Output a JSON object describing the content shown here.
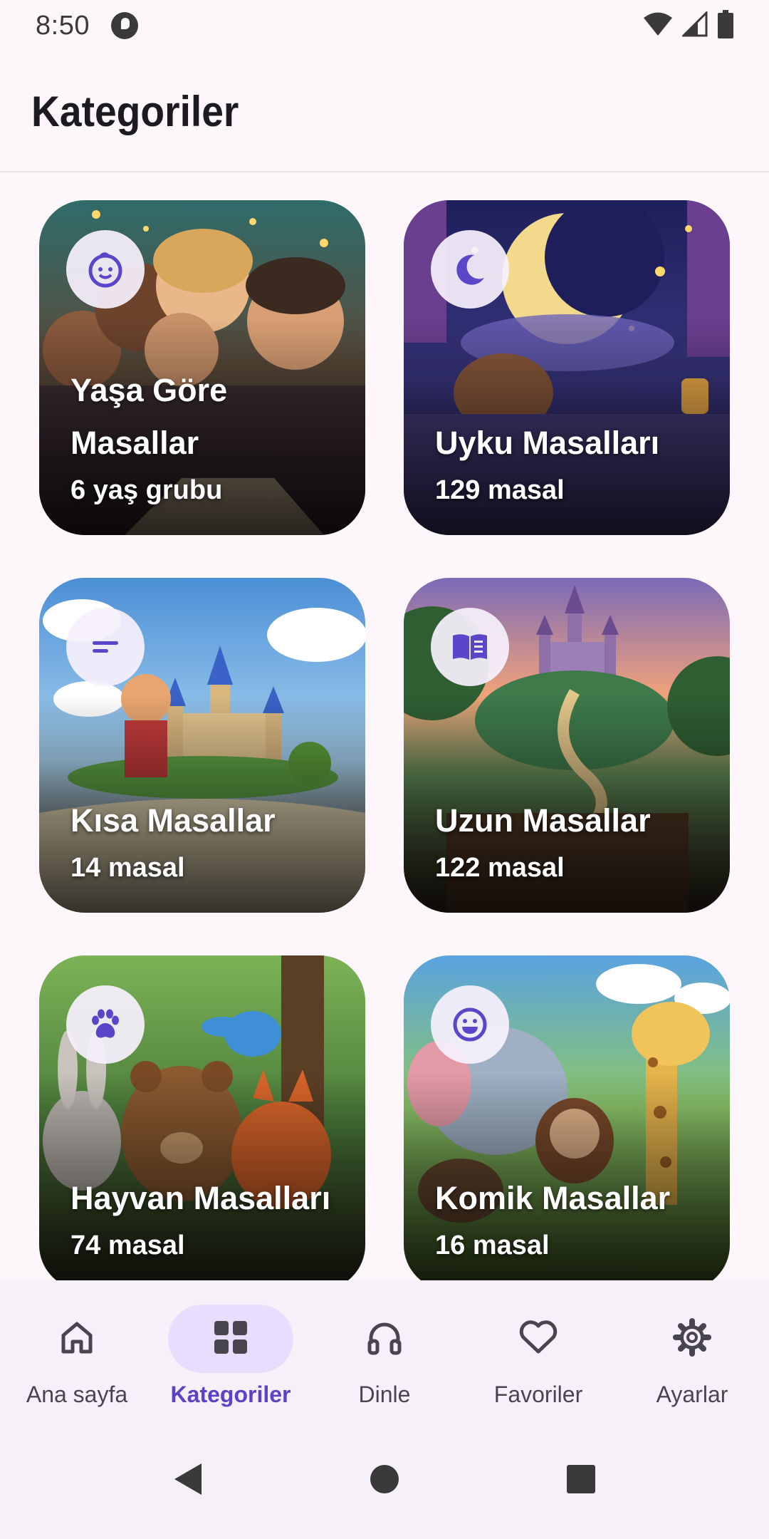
{
  "status_bar": {
    "time": "8:50"
  },
  "header": {
    "title": "Kategoriler"
  },
  "categories": [
    {
      "title": "Yaşa Göre Masallar",
      "subtitle": "6 yaş grubu",
      "icon": "baby-face-icon"
    },
    {
      "title": "Uyku Masalları",
      "subtitle": "129 masal",
      "icon": "moon-icon"
    },
    {
      "title": "Kısa Masallar",
      "subtitle": "14 masal",
      "icon": "short-text-icon"
    },
    {
      "title": "Uzun Masallar",
      "subtitle": "122 masal",
      "icon": "open-book-icon"
    },
    {
      "title": "Hayvan Masalları",
      "subtitle": "74 masal",
      "icon": "paw-icon"
    },
    {
      "title": "Komik Masallar",
      "subtitle": "16 masal",
      "icon": "smiley-icon"
    }
  ],
  "bottom_nav": {
    "active": "Kategoriler",
    "items": [
      {
        "label": "Ana sayfa",
        "icon": "home-icon"
      },
      {
        "label": "Kategoriler",
        "icon": "grid-icon"
      },
      {
        "label": "Dinle",
        "icon": "headphones-icon"
      },
      {
        "label": "Favoriler",
        "icon": "heart-icon"
      },
      {
        "label": "Ayarlar",
        "icon": "gear-icon"
      }
    ]
  },
  "colors": {
    "accent": "#5a43c4",
    "icon_purple": "#5b45c9",
    "nav_pill_bg": "#e8ddfc",
    "background": "#fdf7fb"
  }
}
